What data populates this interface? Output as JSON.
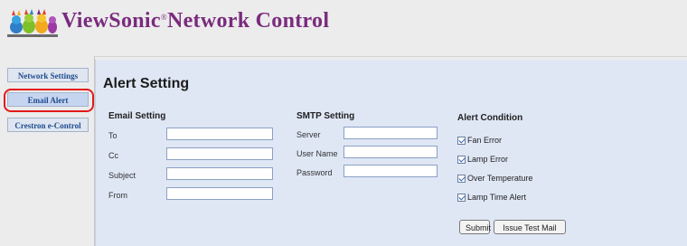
{
  "header": {
    "brand_name": "ViewSonic",
    "brand_mark": "®",
    "brand_suffix": "Network Control",
    "logo_icon": "birds-logo-icon"
  },
  "sidebar": {
    "items": [
      {
        "label": "Network Settings",
        "active": false
      },
      {
        "label": "Email Alert",
        "active": true
      },
      {
        "label": "Crestron e-Control",
        "active": false
      }
    ],
    "highlight_color": "#e21a1a"
  },
  "main": {
    "title": "Alert Setting",
    "email_setting": {
      "title": "Email Setting",
      "fields": [
        {
          "label": "To",
          "value": ""
        },
        {
          "label": "Cc",
          "value": ""
        },
        {
          "label": "Subject",
          "value": ""
        },
        {
          "label": "From",
          "value": ""
        }
      ]
    },
    "smtp_setting": {
      "title": "SMTP Setting",
      "fields": [
        {
          "label": "Server",
          "value": ""
        },
        {
          "label": "User Name",
          "value": ""
        },
        {
          "label": "Password",
          "value": ""
        }
      ]
    },
    "alert_condition": {
      "title": "Alert Condition",
      "items": [
        {
          "label": "Fan Error",
          "checked": true
        },
        {
          "label": "Lamp Error",
          "checked": true
        },
        {
          "label": "Over Temperature",
          "checked": true
        },
        {
          "label": "Lamp Time Alert",
          "checked": true
        }
      ]
    },
    "buttons": {
      "submit": "Submit",
      "issue_test_mail": "Issue Test Mail"
    }
  },
  "colors": {
    "brand": "#7a2b7e",
    "panel_bg": "#dfe7f5",
    "nav_text": "#1e4b8e"
  }
}
